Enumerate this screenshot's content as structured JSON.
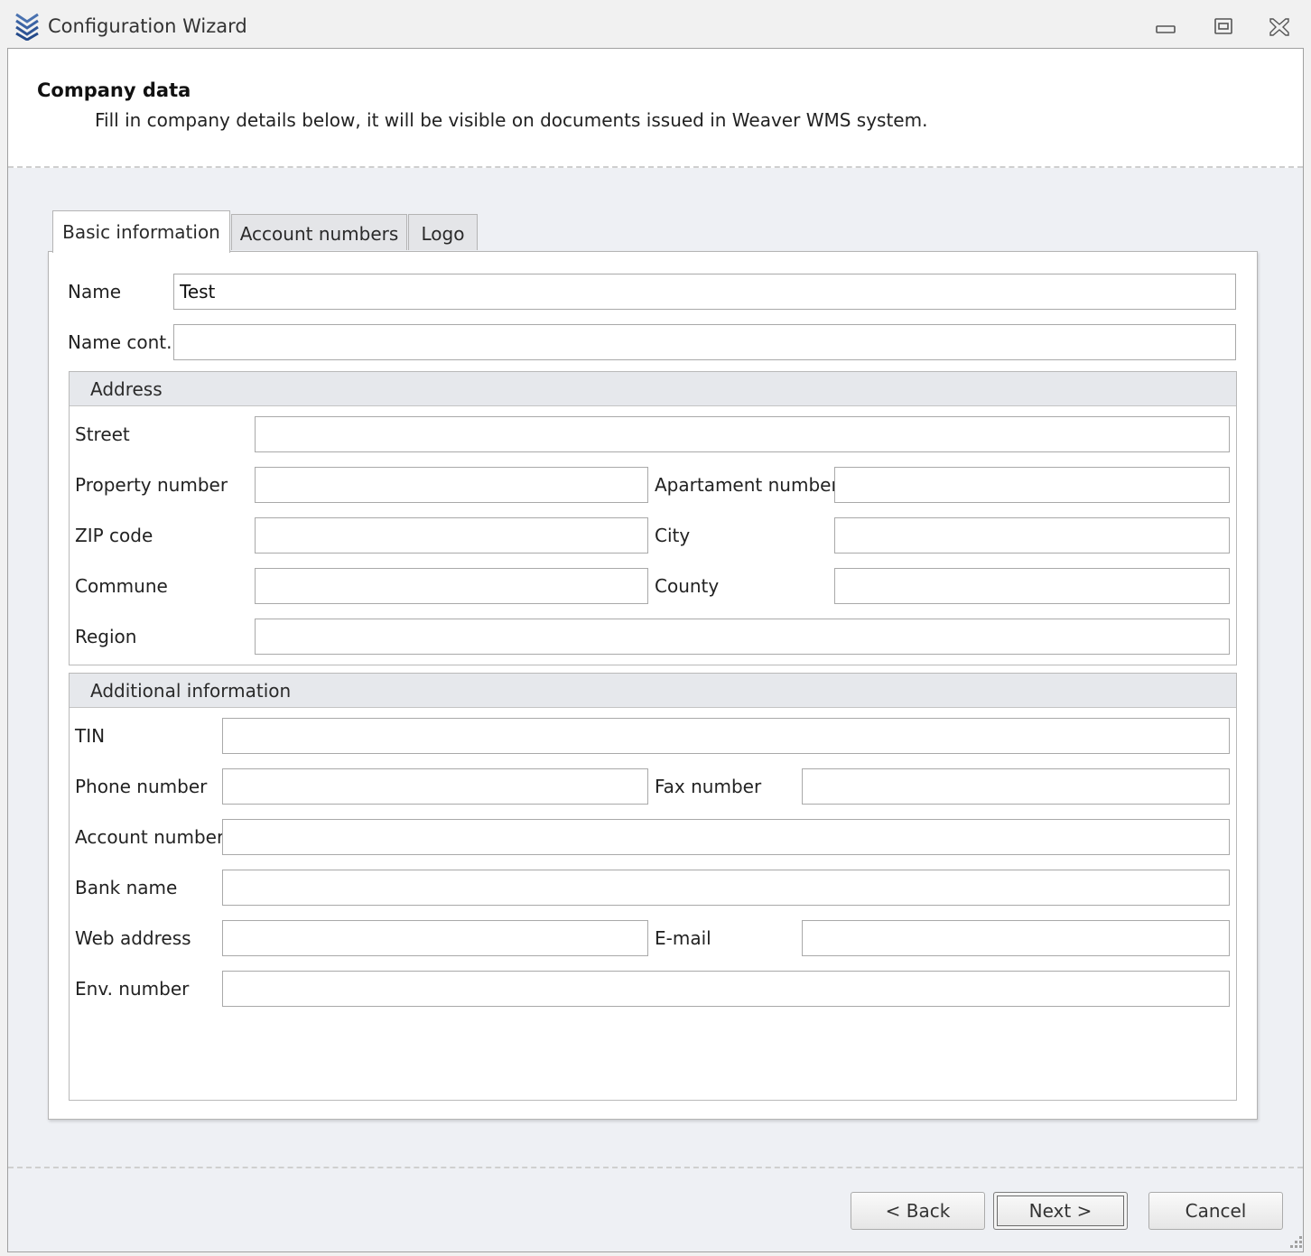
{
  "window": {
    "title": "Configuration Wizard",
    "icons": {
      "app": "chevrons-down-icon",
      "minimize": "minimize-icon",
      "maximize": "restore-icon",
      "close": "close-icon"
    }
  },
  "header": {
    "title": "Company data",
    "subtitle": "Fill in company details below, it will be visible on documents issued in Weaver WMS system."
  },
  "tabs": [
    {
      "label": "Basic information",
      "selected": true
    },
    {
      "label": "Account numbers",
      "selected": false
    },
    {
      "label": "Logo",
      "selected": false
    }
  ],
  "basic": {
    "name": {
      "label": "Name",
      "value": "Test"
    },
    "name_cont": {
      "label": "Name cont.",
      "value": ""
    }
  },
  "address": {
    "title": "Address",
    "street": {
      "label": "Street",
      "value": ""
    },
    "property_number": {
      "label": "Property number",
      "value": ""
    },
    "apartment_number": {
      "label": "Apartament number",
      "value": ""
    },
    "zip": {
      "label": "ZIP code",
      "value": ""
    },
    "city": {
      "label": "City",
      "value": ""
    },
    "commune": {
      "label": "Commune",
      "value": ""
    },
    "county": {
      "label": "County",
      "value": ""
    },
    "region": {
      "label": "Region",
      "value": ""
    }
  },
  "additional": {
    "title": "Additional information",
    "tin": {
      "label": "TIN",
      "value": ""
    },
    "phone": {
      "label": "Phone number",
      "value": ""
    },
    "fax": {
      "label": "Fax number",
      "value": ""
    },
    "account": {
      "label": "Account number",
      "value": ""
    },
    "bank": {
      "label": "Bank name",
      "value": ""
    },
    "web": {
      "label": "Web address",
      "value": ""
    },
    "email": {
      "label": "E-mail",
      "value": ""
    },
    "env": {
      "label": "Env. number",
      "value": ""
    }
  },
  "buttons": {
    "back": "< Back",
    "next": "Next >",
    "cancel": "Cancel"
  },
  "colors": {
    "panel_bg": "#eef0f4",
    "header_bg": "#ffffff",
    "group_header_bg": "#e6e8ec",
    "border": "#a9a9a9"
  }
}
